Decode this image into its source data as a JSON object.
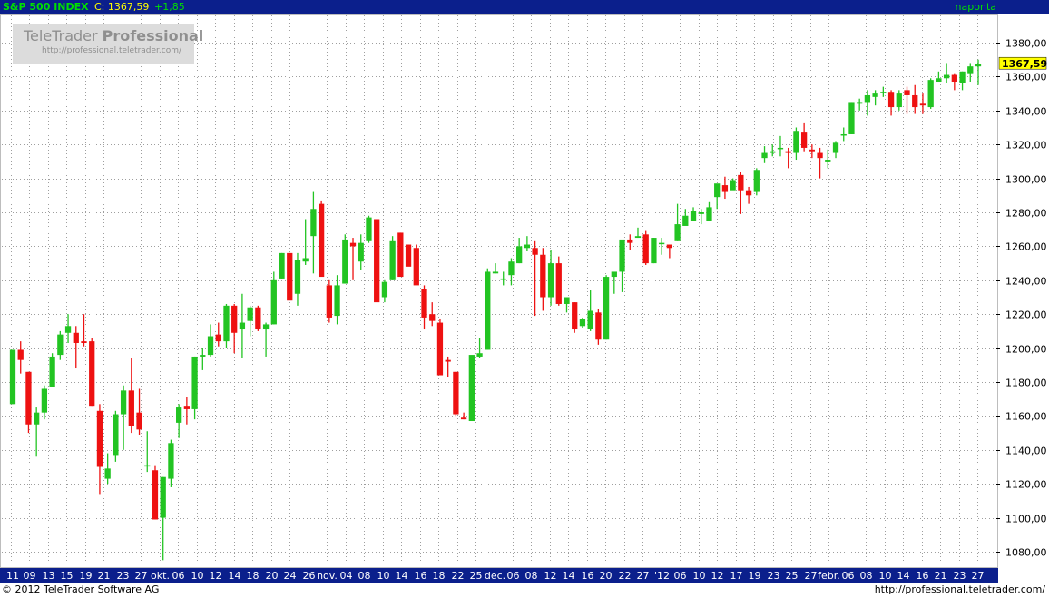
{
  "header": {
    "symbol": "S&P 500 INDEX",
    "close_label": "C: 1367,59",
    "change": "+1,85",
    "period": "naponta"
  },
  "watermark": {
    "brand_regular": "TeleTrader",
    "brand_bold": "Professional",
    "url": "http://professional.teletrader.com/"
  },
  "footer": {
    "copyright": "© 2012 TeleTrader Software AG",
    "url": "http://professional.teletrader.com/"
  },
  "colors": {
    "up": "#22c422",
    "down": "#ee1111",
    "header_bg": "#0b1f8c",
    "header_green": "#00e000",
    "last_price_box": "#ffff00",
    "grid": "#9e9e9e"
  },
  "chart_data": {
    "type": "candlestick",
    "last_price_label": "1367,59",
    "ylim": [
      1070,
      1390
    ],
    "y_ticks": [
      "1080,00",
      "1100,00",
      "1120,00",
      "1140,00",
      "1160,00",
      "1180,00",
      "1200,00",
      "1220,00",
      "1240,00",
      "1260,00",
      "1280,00",
      "1300,00",
      "1320,00",
      "1340,00",
      "1360,00",
      "1380,00"
    ],
    "x_ticks": [
      "'11",
      "09",
      "13",
      "15",
      "19",
      "21",
      "23",
      "27",
      "okt.",
      "06",
      "10",
      "12",
      "14",
      "18",
      "20",
      "24",
      "26",
      "nov.",
      "04",
      "08",
      "10",
      "14",
      "16",
      "18",
      "22",
      "25",
      "dec.",
      "06",
      "08",
      "12",
      "14",
      "16",
      "20",
      "22",
      "27",
      "'12",
      "06",
      "10",
      "12",
      "17",
      "19",
      "23",
      "25",
      "27",
      "febr.",
      "06",
      "08",
      "10",
      "14",
      "16",
      "21",
      "23",
      "27"
    ],
    "grid": "dotted",
    "candles": [
      [
        1167,
        1199,
        1167,
        1199
      ],
      [
        1199,
        1204,
        1185,
        1193
      ],
      [
        1186,
        1186,
        1150,
        1155
      ],
      [
        1155,
        1165,
        1136,
        1162
      ],
      [
        1162,
        1178,
        1158,
        1176
      ],
      [
        1177,
        1197,
        1177,
        1195
      ],
      [
        1196,
        1210,
        1193,
        1208
      ],
      [
        1209,
        1220,
        1203,
        1213
      ],
      [
        1209,
        1213,
        1188,
        1203
      ],
      [
        1204,
        1220,
        1201,
        1203
      ],
      [
        1204,
        1206,
        1166,
        1166
      ],
      [
        1163,
        1167,
        1114,
        1130
      ],
      [
        1123,
        1138,
        1120,
        1129
      ],
      [
        1137,
        1163,
        1133,
        1161
      ],
      [
        1161,
        1178,
        1140,
        1175
      ],
      [
        1175,
        1194,
        1150,
        1154
      ],
      [
        1162,
        1176,
        1149,
        1152
      ],
      [
        1131,
        1151,
        1127,
        1131
      ],
      [
        1128,
        1131,
        1099,
        1099
      ],
      [
        1100,
        1124,
        1075,
        1124
      ],
      [
        1123,
        1146,
        1118,
        1144
      ],
      [
        1156,
        1167,
        1147,
        1165
      ],
      [
        1166,
        1171,
        1155,
        1164
      ],
      [
        1164,
        1195,
        1158,
        1195
      ],
      [
        1195,
        1200,
        1187,
        1196
      ],
      [
        1196,
        1214,
        1195,
        1207
      ],
      [
        1208,
        1215,
        1201,
        1204
      ],
      [
        1204,
        1226,
        1200,
        1225
      ],
      [
        1225,
        1226,
        1197,
        1209
      ],
      [
        1211,
        1232,
        1194,
        1215
      ],
      [
        1216,
        1225,
        1207,
        1224
      ],
      [
        1224,
        1225,
        1210,
        1211
      ],
      [
        1211,
        1215,
        1195,
        1214
      ],
      [
        1214,
        1245,
        1214,
        1240
      ],
      [
        1241,
        1256,
        1241,
        1256
      ],
      [
        1256,
        1256,
        1229,
        1228
      ],
      [
        1232,
        1256,
        1225,
        1252
      ],
      [
        1251,
        1276,
        1249,
        1253
      ],
      [
        1266,
        1292,
        1244,
        1282
      ],
      [
        1285,
        1287,
        1247,
        1242
      ],
      [
        1237,
        1240,
        1215,
        1218
      ],
      [
        1219,
        1243,
        1214,
        1237
      ],
      [
        1238,
        1267,
        1238,
        1264
      ],
      [
        1262,
        1265,
        1240,
        1260
      ],
      [
        1251,
        1267,
        1246,
        1262
      ],
      [
        1263,
        1278,
        1262,
        1277
      ],
      [
        1276,
        1276,
        1232,
        1227
      ],
      [
        1230,
        1240,
        1227,
        1239
      ],
      [
        1240,
        1266,
        1240,
        1263
      ],
      [
        1268,
        1268,
        1243,
        1242
      ],
      [
        1261,
        1261,
        1249,
        1248
      ],
      [
        1259,
        1261,
        1238,
        1237
      ],
      [
        1235,
        1237,
        1211,
        1218
      ],
      [
        1220,
        1227,
        1213,
        1216
      ],
      [
        1215,
        1217,
        1188,
        1184
      ],
      [
        1193,
        1195,
        1183,
        1192
      ],
      [
        1186,
        1186,
        1160,
        1161
      ],
      [
        1159,
        1162,
        1158,
        1158
      ],
      [
        1157,
        1195,
        1157,
        1196
      ],
      [
        1195,
        1206,
        1194,
        1197
      ],
      [
        1199,
        1247,
        1199,
        1245
      ],
      [
        1244,
        1250,
        1244,
        1245
      ],
      [
        1241,
        1245,
        1237,
        1241
      ],
      [
        1243,
        1253,
        1237,
        1251
      ],
      [
        1250,
        1265,
        1250,
        1260
      ],
      [
        1259,
        1266,
        1257,
        1261
      ],
      [
        1259,
        1263,
        1219,
        1255
      ],
      [
        1255,
        1259,
        1222,
        1230
      ],
      [
        1230,
        1258,
        1225,
        1250
      ],
      [
        1250,
        1254,
        1225,
        1226
      ],
      [
        1226,
        1227,
        1221,
        1230
      ],
      [
        1227,
        1227,
        1209,
        1211
      ],
      [
        1213,
        1218,
        1212,
        1217
      ],
      [
        1211,
        1234,
        1210,
        1222
      ],
      [
        1221,
        1223,
        1202,
        1205
      ],
      [
        1205,
        1243,
        1205,
        1242
      ],
      [
        1242,
        1243,
        1232,
        1245
      ],
      [
        1245,
        1246,
        1233,
        1264
      ],
      [
        1264,
        1267,
        1258,
        1262
      ],
      [
        1265,
        1271,
        1265,
        1266
      ],
      [
        1267,
        1269,
        1249,
        1250
      ],
      [
        1250,
        1265,
        1250,
        1265
      ],
      [
        1262,
        1265,
        1255,
        1262
      ],
      [
        1261,
        1261,
        1253,
        1259
      ],
      [
        1263,
        1285,
        1263,
        1273
      ],
      [
        1272,
        1282,
        1275,
        1278
      ],
      [
        1275,
        1283,
        1281,
        1281
      ],
      [
        1279,
        1282,
        1273,
        1280
      ],
      [
        1275,
        1286,
        1275,
        1283
      ],
      [
        1289,
        1293,
        1282,
        1297
      ],
      [
        1296,
        1301,
        1288,
        1292
      ],
      [
        1293,
        1300,
        1298,
        1299
      ],
      [
        1302,
        1304,
        1279,
        1293
      ],
      [
        1293,
        1295,
        1285,
        1290
      ],
      [
        1292,
        1306,
        1290,
        1305
      ],
      [
        1312,
        1319,
        1309,
        1315
      ],
      [
        1315,
        1320,
        1313,
        1316
      ],
      [
        1318,
        1325,
        1313,
        1318
      ],
      [
        1316,
        1318,
        1306,
        1315
      ],
      [
        1315,
        1330,
        1311,
        1328
      ],
      [
        1327,
        1333,
        1316,
        1318
      ],
      [
        1317,
        1320,
        1312,
        1316
      ],
      [
        1315,
        1318,
        1300,
        1312
      ],
      [
        1310,
        1317,
        1306,
        1311
      ],
      [
        1315,
        1322,
        1312,
        1321
      ],
      [
        1326,
        1330,
        1322,
        1326
      ],
      [
        1326,
        1345,
        1326,
        1345
      ],
      [
        1344,
        1347,
        1340,
        1345
      ],
      [
        1345,
        1352,
        1337,
        1349
      ],
      [
        1348,
        1352,
        1343,
        1350
      ],
      [
        1351,
        1354,
        1348,
        1351
      ],
      [
        1351,
        1352,
        1337,
        1342
      ],
      [
        1342,
        1352,
        1340,
        1350
      ],
      [
        1352,
        1354,
        1338,
        1349
      ],
      [
        1349,
        1355,
        1338,
        1342
      ],
      [
        1344,
        1350,
        1338,
        1343
      ],
      [
        1342,
        1359,
        1341,
        1358
      ],
      [
        1357,
        1363,
        1357,
        1359
      ],
      [
        1359,
        1368,
        1356,
        1361
      ],
      [
        1361,
        1362,
        1352,
        1357
      ],
      [
        1356,
        1363,
        1352,
        1363
      ],
      [
        1362,
        1368,
        1357,
        1366
      ],
      [
        1366,
        1370,
        1355,
        1367.59
      ]
    ]
  }
}
